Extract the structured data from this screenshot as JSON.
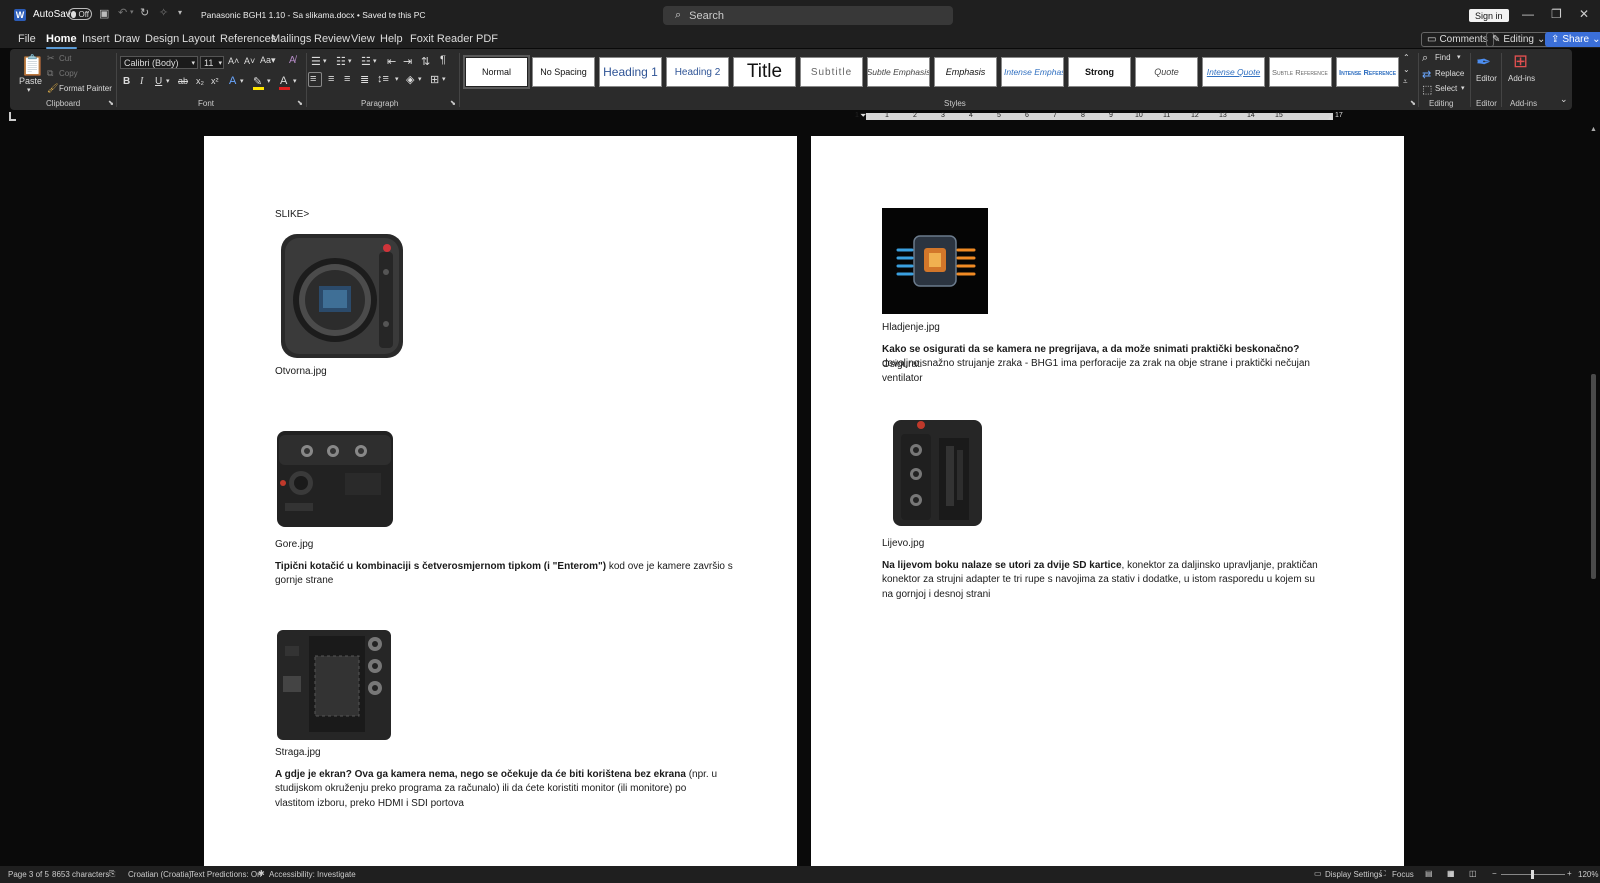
{
  "titlebar": {
    "app_icon": "W",
    "autosave_label": "AutoSave",
    "autosave_state": "Off",
    "doc_title": "Panasonic BGH1 1.10 - Sa slikama.docx • Saved to this PC",
    "search_placeholder": "Search",
    "sign_in": "Sign in"
  },
  "menu": {
    "tabs": [
      "File",
      "Home",
      "Insert",
      "Draw",
      "Design",
      "Layout",
      "References",
      "Mailings",
      "Review",
      "View",
      "Help",
      "Foxit Reader PDF"
    ],
    "active": "Home",
    "comments": "Comments",
    "editing": "Editing",
    "share": "Share"
  },
  "ribbon": {
    "clipboard": {
      "paste": "Paste",
      "cut": "Cut",
      "copy": "Copy",
      "format_painter": "Format Painter",
      "label": "Clipboard"
    },
    "font": {
      "name": "Calibri (Body)",
      "size": "11",
      "label": "Font"
    },
    "paragraph": {
      "label": "Paragraph"
    },
    "styles": {
      "items": [
        "Normal",
        "No Spacing",
        "Heading 1",
        "Heading 2",
        "Title",
        "Subtitle",
        "Subtle Emphasis",
        "Emphasis",
        "Intense Emphasis",
        "Strong",
        "Quote",
        "Intense Quote",
        "Subtle Reference",
        "Intense Reference"
      ],
      "label": "Styles"
    },
    "editing": {
      "find": "Find",
      "replace": "Replace",
      "select": "Select",
      "label": "Editing"
    },
    "editor": {
      "label": "Editor",
      "group": "Editor"
    },
    "addins": {
      "label": "Add-ins",
      "group": "Add-ins"
    }
  },
  "ruler": {
    "numbers": [
      "1",
      "2",
      "1",
      "2",
      "3",
      "4",
      "5",
      "6",
      "7",
      "8",
      "9",
      "10",
      "11",
      "12",
      "13",
      "14",
      "15",
      "17"
    ]
  },
  "page_left": {
    "heading": "SLIKE>",
    "img1_caption": "Otvorna.jpg",
    "img2_caption": "Gore.jpg",
    "p2_bold": "Tipični kotačić u kombinaciji s četverosmjernom tipkom (i \"Enterom\")",
    "p2_line1_rest": " kod ove je kamere završio s",
    "p2_line2": "gornje strane",
    "img3_caption": "Straga.jpg",
    "p3_bold": "A gdje je ekran? Ova ga kamera nema, nego se očekuje da će biti korištena bez ekrana",
    "p3_line1_rest": " (npr. u",
    "p3_line2": "studijskom okruženju preko programa za računalo) ili da ćete koristiti monitor (ili monitore) po",
    "p3_line3": "vlastitom izboru, preko HDMI i SDI portova"
  },
  "page_right": {
    "img4_caption": "Hladjenje.jpg",
    "p4_bold": "Kako se osigurati da se kamera ne pregrijava, a da može snimati praktički beskonačno?",
    "p4_line1_rest": " Osigurati",
    "p4_line2": "dovoljno snažno strujanje zraka - BHG1 ima perforacije za zrak na obje strane i praktički nečujan",
    "p4_line3": "ventilator",
    "img5_caption": "Lijevo.jpg",
    "p5_bold": "Na lijevom boku nalaze se utori za dvije SD kartice",
    "p5_line1_rest": ", konektor za daljinsko upravljanje, praktičan",
    "p5_line2": "konektor za strujni adapter te tri rupe s navojima za stativ i dodatke, u istom rasporedu u kojem su",
    "p5_line3": "na gornjoj i desnoj strani"
  },
  "status": {
    "page": "Page 3 of 5",
    "chars": "8653 characters",
    "language": "Croatian (Croatia)",
    "predictions": "Text Predictions: On",
    "accessibility": "Accessibility: Investigate",
    "display": "Display Settings",
    "focus": "Focus",
    "zoom": "120%"
  }
}
